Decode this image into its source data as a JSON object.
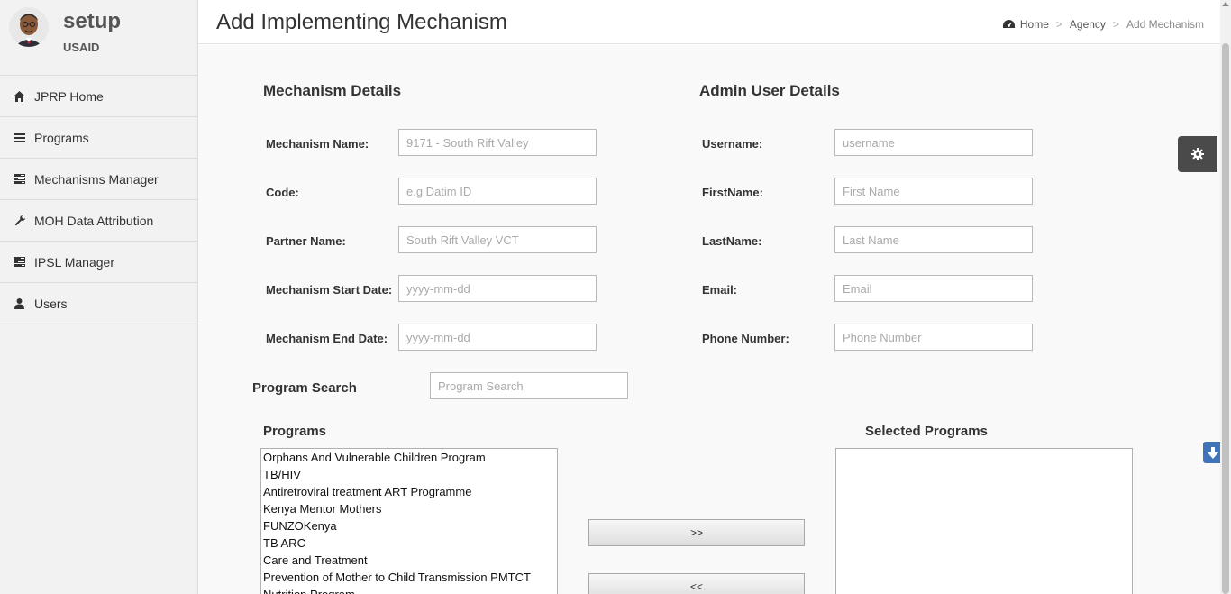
{
  "profile": {
    "name": "setup",
    "org": "USAID"
  },
  "nav": [
    {
      "label": "JPRP Home",
      "icon": "home-icon"
    },
    {
      "label": "Programs",
      "icon": "bars-icon"
    },
    {
      "label": "Mechanisms Manager",
      "icon": "tasks-icon"
    },
    {
      "label": "MOH Data Attribution",
      "icon": "wrench-icon"
    },
    {
      "label": "IPSL Manager",
      "icon": "tasks-icon"
    },
    {
      "label": "Users",
      "icon": "user-icon"
    }
  ],
  "header": {
    "title": "Add Implementing Mechanism",
    "breadcrumb": {
      "home": "Home",
      "sep": ">",
      "agency": "Agency",
      "current": "Add Mechanism"
    }
  },
  "mechanism": {
    "title": "Mechanism Details",
    "name_label": "Mechanism Name:",
    "name_placeholder": "9171 - South Rift Valley",
    "code_label": "Code:",
    "code_placeholder": "e.g Datim ID",
    "partner_label": "Partner Name:",
    "partner_placeholder": "South Rift Valley VCT",
    "start_label": "Mechanism Start Date:",
    "start_placeholder": "yyyy-mm-dd",
    "end_label": "Mechanism End Date:",
    "end_placeholder": "yyyy-mm-dd"
  },
  "admin": {
    "title": "Admin User Details",
    "username_label": "Username:",
    "username_placeholder": "username",
    "first_label": "FirstName:",
    "first_placeholder": "First Name",
    "last_label": "LastName:",
    "last_placeholder": "Last Name",
    "email_label": "Email:",
    "email_placeholder": "Email",
    "phone_label": "Phone Number:",
    "phone_placeholder": "Phone Number"
  },
  "program_search": {
    "label": "Program Search",
    "placeholder": "Program Search"
  },
  "programs": {
    "title": "Programs",
    "items": [
      "Orphans And Vulnerable Children Program",
      "TB/HIV",
      "Antiretroviral treatment ART Programme",
      "Kenya Mentor Mothers",
      "FUNZOKenya",
      "TB ARC",
      "Care and Treatment",
      "Prevention of Mother to Child Transmission PMTCT",
      "Nutrition Program"
    ]
  },
  "selected_programs": {
    "title": "Selected Programs"
  },
  "buttons": {
    "add": ">>",
    "remove": "<<"
  },
  "colors": {
    "sidebar_bg": "#f2f2f2",
    "settings_bg": "#4a4a4a",
    "scroll_btn": "#3f74b8"
  }
}
